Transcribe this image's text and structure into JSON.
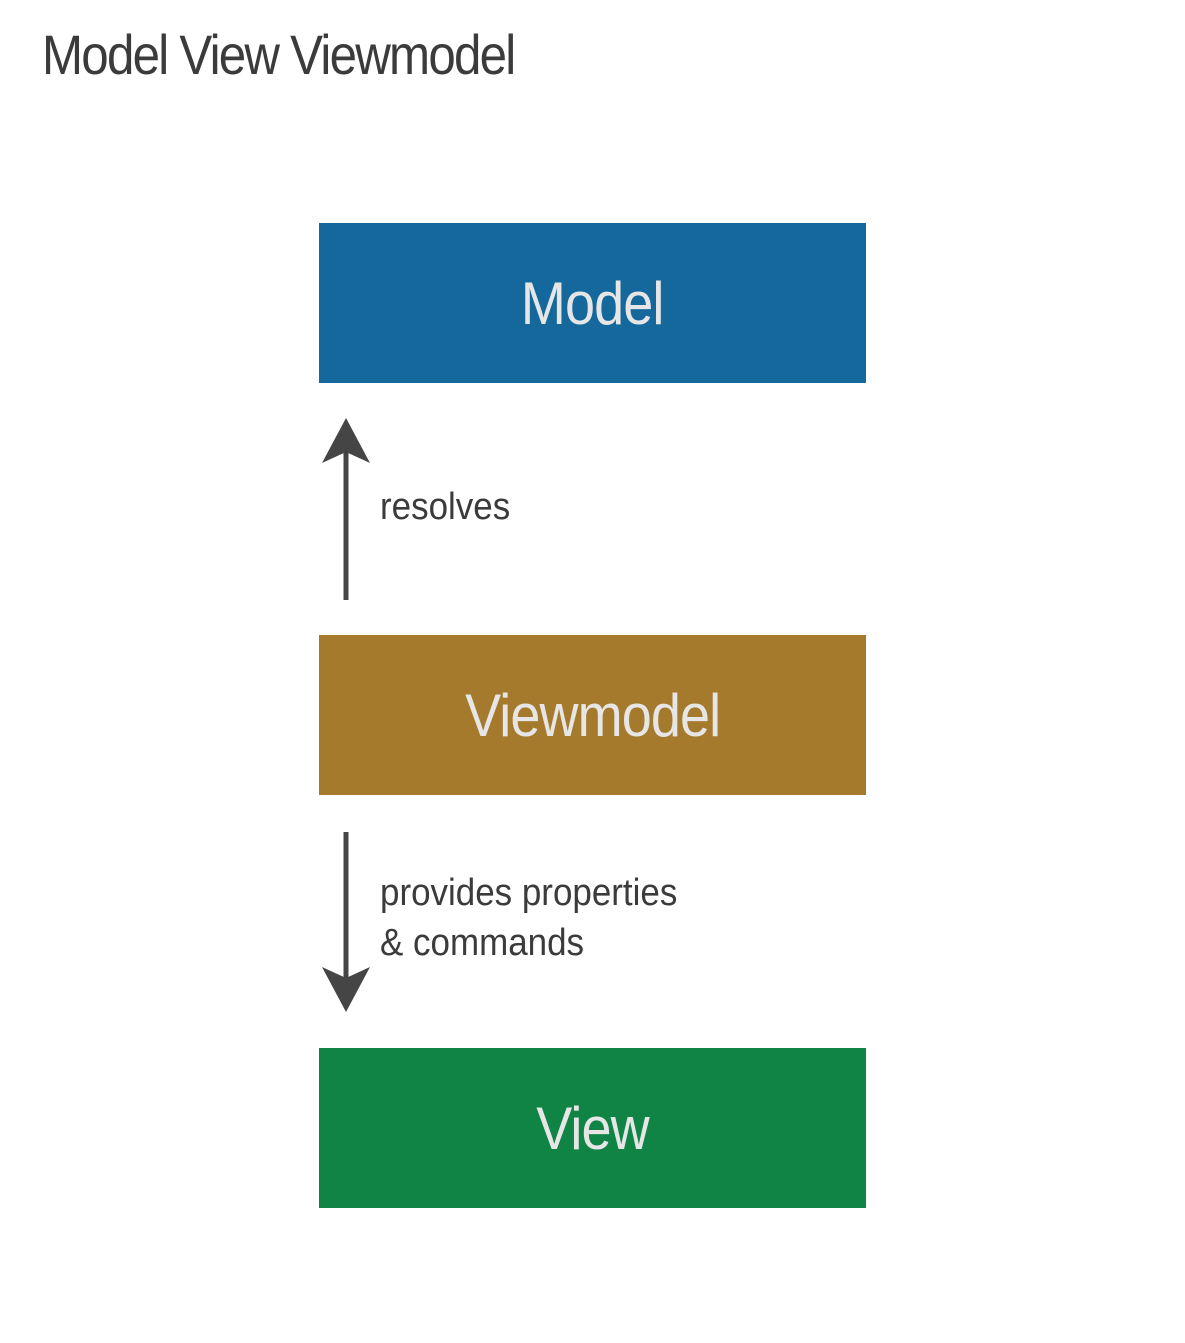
{
  "title": "Model View Viewmodel",
  "boxes": {
    "model": {
      "label": "Model",
      "color": "#14689c"
    },
    "viewmodel": {
      "label": "Viewmodel",
      "color": "#a67a2d"
    },
    "view": {
      "label": "View",
      "color": "#108444"
    }
  },
  "arrows": {
    "resolves": {
      "direction": "up",
      "label": "resolves"
    },
    "provides": {
      "direction": "down",
      "label_line1": "provides properties",
      "label_line2": "& commands"
    }
  },
  "colors": {
    "text": "#3b3b3b",
    "box_text": "#e6e6e6",
    "arrow": "#454545"
  }
}
